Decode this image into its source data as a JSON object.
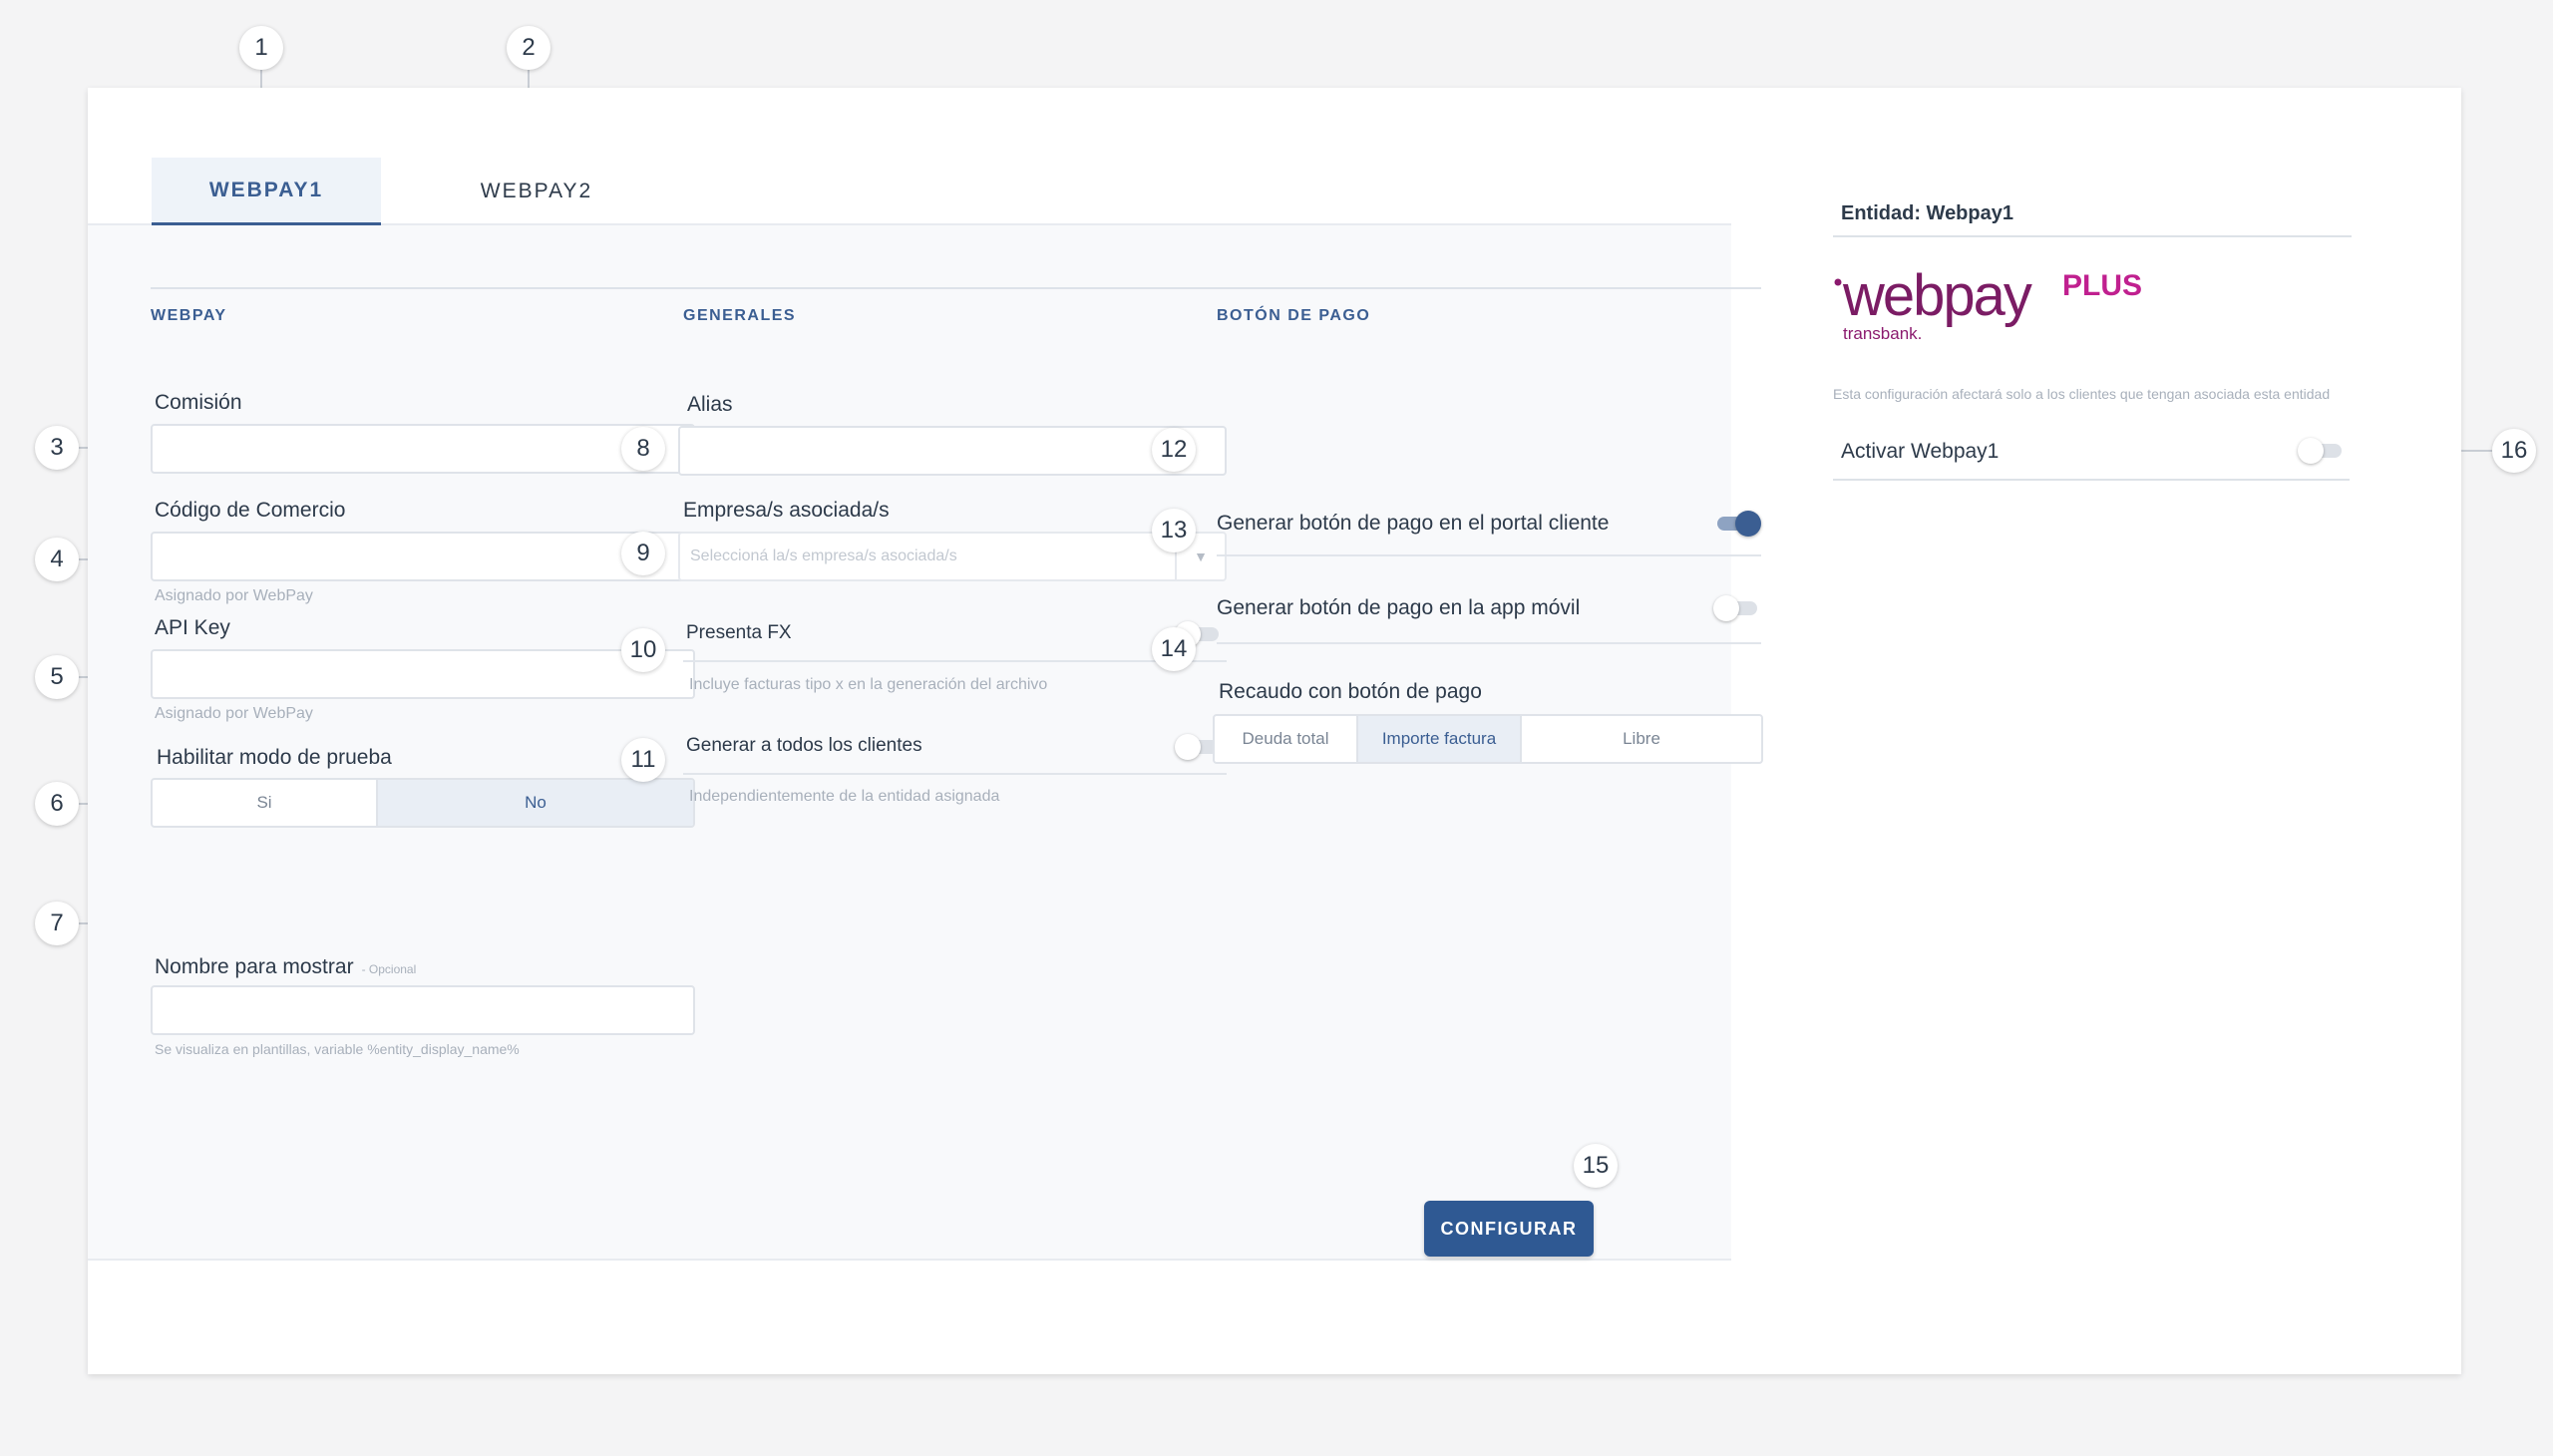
{
  "tabs": {
    "tab1": "WEBPAY1",
    "tab2": "WEBPAY2"
  },
  "webpay": {
    "title": "WEBPAY",
    "comision_label": "Comisión",
    "codigo_label": "Código de Comercio",
    "codigo_hint": "Asignado por WebPay",
    "apikey_label": "API Key",
    "apikey_hint": "Asignado por WebPay",
    "prueba_label": "Habilitar modo de prueba",
    "prueba_si": "Si",
    "prueba_no": "No",
    "prueba_selected": "No",
    "nombre_label": "Nombre para mostrar",
    "nombre_optional": "- Opcional",
    "nombre_hint": "Se visualiza en plantillas, variable %entity_display_name%"
  },
  "generales": {
    "title": "GENERALES",
    "alias_label": "Alias",
    "empresas_label": "Empresa/s asociada/s",
    "empresas_placeholder": "Seleccioná la/s empresa/s asociada/s",
    "fx_label": "Presenta FX",
    "fx_hint": "Incluye facturas tipo x en la generación del archivo",
    "fx_on": false,
    "todos_label": "Generar a todos los clientes",
    "todos_hint": "Independientemente de la entidad asignada",
    "todos_on": false
  },
  "boton": {
    "title": "BOTÓN DE PAGO",
    "portal_label": "Generar botón de pago en el portal cliente",
    "portal_on": true,
    "app_label": "Generar botón de pago en la app móvil",
    "app_on": false,
    "recaudo_label": "Recaudo con botón de pago",
    "opt_deuda": "Deuda total",
    "opt_importe": "Importe factura",
    "opt_libre": "Libre",
    "recaudo_selected": "Importe factura"
  },
  "footer": {
    "configurar": "CONFIGURAR"
  },
  "entity": {
    "title": "Entidad: Webpay1",
    "logo_main": "webpay",
    "logo_plus": "PLUS",
    "logo_sub": "transbank.",
    "note": "Esta configuración afectará solo a los clientes que tengan asociada esta entidad",
    "activar_label": "Activar Webpay1",
    "activar_on": false
  },
  "callouts": [
    "1",
    "2",
    "3",
    "4",
    "5",
    "6",
    "7",
    "8",
    "9",
    "10",
    "11",
    "12",
    "13",
    "14",
    "15",
    "16"
  ],
  "colors": {
    "accent": "#3b5e92",
    "button": "#2f5993",
    "logo": "#8b1a6e"
  }
}
